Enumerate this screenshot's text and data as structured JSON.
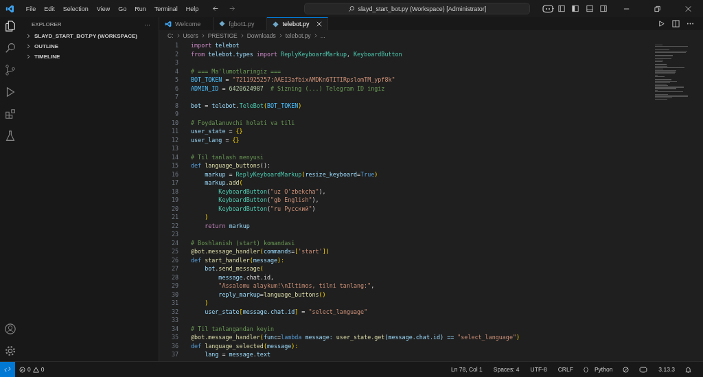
{
  "title_bar": {
    "menus": [
      "File",
      "Edit",
      "Selection",
      "View",
      "Go",
      "Run",
      "Terminal",
      "Help"
    ],
    "command_center": "slayd_start_bot.py (Workspace) [Administrator]"
  },
  "sidebar": {
    "title": "EXPLORER",
    "more": "···",
    "sections": [
      {
        "label": "SLAYD_START_BOT.PY (WORKSPACE)",
        "expanded": false
      },
      {
        "label": "OUTLINE",
        "expanded": false
      },
      {
        "label": "TIMELINE",
        "expanded": false
      }
    ]
  },
  "tabs": [
    {
      "label": "Welcome",
      "kind": "welcome",
      "selected": false
    },
    {
      "label": "fgbot1.py",
      "kind": "python",
      "selected": false
    },
    {
      "label": "telebot.py",
      "kind": "python",
      "selected": true
    }
  ],
  "breadcrumb": [
    "C:",
    "Users",
    "PRESTIGE",
    "Downloads",
    "telebot.py",
    "..."
  ],
  "code": [
    {
      "number": "1",
      "tokens": [
        {
          "text": "import",
          "kind": "kw"
        },
        {
          "text": " telebot",
          "kind": "var"
        }
      ]
    },
    {
      "number": "2",
      "tokens": [
        {
          "text": "from",
          "kind": "kw"
        },
        {
          "text": " telebot.types ",
          "kind": "var"
        },
        {
          "text": "import",
          "kind": "kw"
        },
        {
          "text": " ReplyKeyboardMarkup",
          "kind": "cls"
        },
        {
          "text": ", ",
          "kind": "plain"
        },
        {
          "text": "KeyboardButton",
          "kind": "cls"
        }
      ]
    },
    {
      "number": "3"
    },
    {
      "number": "4",
      "tokens": [
        {
          "text": "# === Ma'lumotlaringiz ===",
          "kind": "cmt"
        }
      ]
    },
    {
      "number": "5",
      "tokens": [
        {
          "text": "BOT_TOKEN",
          "kind": "const"
        },
        {
          "text": " = ",
          "kind": "plain"
        },
        {
          "text": "\"7211925257:AAEI3afbixAMDKn6TITIRpslomTM_ypf8k\"",
          "kind": "str"
        }
      ]
    },
    {
      "number": "6",
      "tokens": [
        {
          "text": "ADMIN_ID",
          "kind": "const"
        },
        {
          "text": " = ",
          "kind": "plain"
        },
        {
          "text": "6420624987",
          "kind": "num"
        },
        {
          "text": "  # Sizning (...) Telegram ID ingiz",
          "kind": "cmt"
        }
      ]
    },
    {
      "number": "7"
    },
    {
      "number": "8",
      "tokens": [
        {
          "text": "bot",
          "kind": "var"
        },
        {
          "text": " = ",
          "kind": "plain"
        },
        {
          "text": "telebot",
          "kind": "var"
        },
        {
          "text": ".",
          "kind": "plain"
        },
        {
          "text": "TeleBot",
          "kind": "cls"
        },
        {
          "text": "(",
          "kind": "br"
        },
        {
          "text": "BOT_TOKEN",
          "kind": "const"
        },
        {
          "text": ")",
          "kind": "br"
        }
      ]
    },
    {
      "number": "9"
    },
    {
      "number": "10",
      "tokens": [
        {
          "text": "# Foydalanuvchi holati va tili",
          "kind": "cmt"
        }
      ]
    },
    {
      "number": "11",
      "tokens": [
        {
          "text": "user_state",
          "kind": "var"
        },
        {
          "text": " = ",
          "kind": "plain"
        },
        {
          "text": "{}",
          "kind": "br"
        }
      ]
    },
    {
      "number": "12",
      "tokens": [
        {
          "text": "user_lang",
          "kind": "var"
        },
        {
          "text": " = ",
          "kind": "plain"
        },
        {
          "text": "{}",
          "kind": "br"
        }
      ]
    },
    {
      "number": "13"
    },
    {
      "number": "14",
      "tokens": [
        {
          "text": "# Til tanlash menyusi",
          "kind": "cmt"
        }
      ]
    },
    {
      "number": "15",
      "tokens": [
        {
          "text": "def",
          "kind": "def"
        },
        {
          "text": " language_buttons",
          "kind": "fn"
        },
        {
          "text": "():",
          "kind": "plain"
        }
      ]
    },
    {
      "number": "16",
      "tokens": [
        {
          "text": "    markup",
          "kind": "var"
        },
        {
          "text": " = ",
          "kind": "plain"
        },
        {
          "text": "ReplyKeyboardMarkup",
          "kind": "cls"
        },
        {
          "text": "(",
          "kind": "br"
        },
        {
          "text": "resize_keyboard",
          "kind": "var"
        },
        {
          "text": "=",
          "kind": "plain"
        },
        {
          "text": "True",
          "kind": "def"
        },
        {
          "text": ")",
          "kind": "br"
        }
      ]
    },
    {
      "number": "17",
      "tokens": [
        {
          "text": "    markup",
          "kind": "var"
        },
        {
          "text": ".",
          "kind": "plain"
        },
        {
          "text": "add",
          "kind": "fn"
        },
        {
          "text": "(",
          "kind": "br"
        }
      ]
    },
    {
      "number": "18",
      "tokens": [
        {
          "text": "        KeyboardButton",
          "kind": "cls"
        },
        {
          "text": "(",
          "kind": "plain"
        },
        {
          "text": "\"uz O'zbekcha\"",
          "kind": "str"
        },
        {
          "text": "),",
          "kind": "plain"
        }
      ]
    },
    {
      "number": "19",
      "tokens": [
        {
          "text": "        KeyboardButton",
          "kind": "cls"
        },
        {
          "text": "(",
          "kind": "plain"
        },
        {
          "text": "\"gb English\"",
          "kind": "str"
        },
        {
          "text": "),",
          "kind": "plain"
        }
      ]
    },
    {
      "number": "20",
      "tokens": [
        {
          "text": "        KeyboardButton",
          "kind": "cls"
        },
        {
          "text": "(",
          "kind": "plain"
        },
        {
          "text": "\"ru Русский\"",
          "kind": "str"
        },
        {
          "text": ")",
          "kind": "plain"
        }
      ]
    },
    {
      "number": "21",
      "tokens": [
        {
          "text": "    )",
          "kind": "br"
        }
      ]
    },
    {
      "number": "22",
      "tokens": [
        {
          "text": "    return",
          "kind": "kw"
        },
        {
          "text": " markup",
          "kind": "var"
        }
      ]
    },
    {
      "number": "23"
    },
    {
      "number": "24",
      "tokens": [
        {
          "text": "# Boshlanish (start) komandasi",
          "kind": "cmt"
        }
      ]
    },
    {
      "number": "25",
      "tokens": [
        {
          "text": "@bot.message_handler",
          "kind": "fn"
        },
        {
          "text": "(",
          "kind": "br"
        },
        {
          "text": "commands",
          "kind": "var"
        },
        {
          "text": "=",
          "kind": "plain"
        },
        {
          "text": "[",
          "kind": "br"
        },
        {
          "text": "'start'",
          "kind": "str"
        },
        {
          "text": "])",
          "kind": "br"
        }
      ]
    },
    {
      "number": "26",
      "tokens": [
        {
          "text": "def",
          "kind": "def"
        },
        {
          "text": " start_handler",
          "kind": "fn"
        },
        {
          "text": "(",
          "kind": "br"
        },
        {
          "text": "message",
          "kind": "var"
        },
        {
          "text": "):",
          "kind": "br"
        }
      ]
    },
    {
      "number": "27",
      "tokens": [
        {
          "text": "    bot",
          "kind": "var"
        },
        {
          "text": ".",
          "kind": "plain"
        },
        {
          "text": "send_message",
          "kind": "fn"
        },
        {
          "text": "(",
          "kind": "br"
        }
      ]
    },
    {
      "number": "28",
      "tokens": [
        {
          "text": "        message",
          "kind": "var"
        },
        {
          "text": ".chat.id,",
          "kind": "plain"
        }
      ]
    },
    {
      "number": "29",
      "tokens": [
        {
          "text": "        \"Assalomu alaykum!\\nIltimos, tilni tanlang:\"",
          "kind": "str"
        },
        {
          "text": ",",
          "kind": "plain"
        }
      ]
    },
    {
      "number": "30",
      "tokens": [
        {
          "text": "        reply_markup",
          "kind": "var"
        },
        {
          "text": "=",
          "kind": "plain"
        },
        {
          "text": "language_buttons",
          "kind": "fn"
        },
        {
          "text": "()",
          "kind": "br"
        }
      ]
    },
    {
      "number": "31",
      "tokens": [
        {
          "text": "    )",
          "kind": "br"
        }
      ]
    },
    {
      "number": "32",
      "tokens": [
        {
          "text": "    user_state",
          "kind": "var"
        },
        {
          "text": "[",
          "kind": "br"
        },
        {
          "text": "message.chat.id",
          "kind": "var"
        },
        {
          "text": "]",
          "kind": "br"
        },
        {
          "text": " = ",
          "kind": "plain"
        },
        {
          "text": "\"select_language\"",
          "kind": "str"
        }
      ]
    },
    {
      "number": "33"
    },
    {
      "number": "34",
      "tokens": [
        {
          "text": "# Til tanlangandan keyin",
          "kind": "cmt"
        }
      ]
    },
    {
      "number": "35",
      "tokens": [
        {
          "text": "@bot.message_handler",
          "kind": "fn"
        },
        {
          "text": "(",
          "kind": "br"
        },
        {
          "text": "func",
          "kind": "var"
        },
        {
          "text": "=",
          "kind": "plain"
        },
        {
          "text": "lambda",
          "kind": "def"
        },
        {
          "text": " message: ",
          "kind": "var"
        },
        {
          "text": "user_state.get",
          "kind": "fn"
        },
        {
          "text": "(message.chat.id) == ",
          "kind": "var"
        },
        {
          "text": "\"select_language\"",
          "kind": "str"
        },
        {
          "text": ")",
          "kind": "br"
        }
      ]
    },
    {
      "number": "36",
      "tokens": [
        {
          "text": "def",
          "kind": "def"
        },
        {
          "text": " language_selected",
          "kind": "fn"
        },
        {
          "text": "(",
          "kind": "br"
        },
        {
          "text": "message",
          "kind": "var"
        },
        {
          "text": "):",
          "kind": "br"
        }
      ]
    },
    {
      "number": "37",
      "tokens": [
        {
          "text": "    lang",
          "kind": "var"
        },
        {
          "text": " = ",
          "kind": "plain"
        },
        {
          "text": "message",
          "kind": "var"
        },
        {
          "text": ".",
          "kind": "plain"
        },
        {
          "text": "text",
          "kind": "var"
        }
      ]
    }
  ],
  "status_bar": {
    "errors": "0",
    "warnings": "0",
    "items": [
      "Ln 78, Col 1",
      "Spaces: 4",
      "UTF-8",
      "CRLF"
    ],
    "language": "Python",
    "version": "3.13.3"
  }
}
